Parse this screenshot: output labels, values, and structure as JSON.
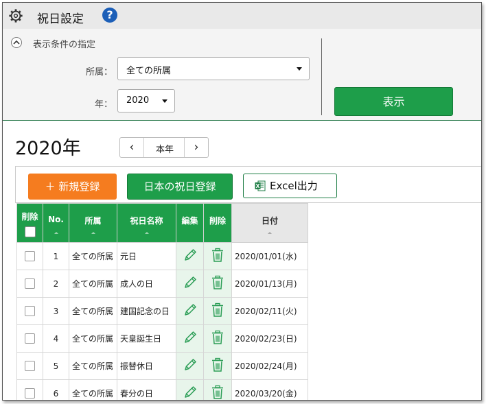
{
  "header": {
    "title": "祝日設定",
    "help_label": "?"
  },
  "filter": {
    "section_title": "表示条件の指定",
    "dept_label": "所属：",
    "dept_value": "全ての所属",
    "year_label": "年：",
    "year_value": "2020",
    "show_button": "表示"
  },
  "year_nav": {
    "title": "2020年",
    "prev": "‹",
    "current": "本年",
    "next": "›"
  },
  "toolbar": {
    "new_button": "＋ 新規登録",
    "jp_holiday_button": "日本の祝日登録",
    "excel_button": "Excel出力"
  },
  "table": {
    "headers": {
      "delete": "削除",
      "no": "No.",
      "dept": "所属",
      "name": "祝日名称",
      "edit": "編集",
      "delete2": "削除",
      "date": "日付"
    },
    "rows": [
      {
        "no": "1",
        "dept": "全ての所属",
        "name": "元日",
        "date": "2020/01/01(水)"
      },
      {
        "no": "2",
        "dept": "全ての所属",
        "name": "成人の日",
        "date": "2020/01/13(月)"
      },
      {
        "no": "3",
        "dept": "全ての所属",
        "name": "建国記念の日",
        "date": "2020/02/11(火)"
      },
      {
        "no": "4",
        "dept": "全ての所属",
        "name": "天皇誕生日",
        "date": "2020/02/23(日)"
      },
      {
        "no": "5",
        "dept": "全ての所属",
        "name": "振替休日",
        "date": "2020/02/24(月)"
      },
      {
        "no": "6",
        "dept": "全ての所属",
        "name": "春分の日",
        "date": "2020/03/20(金)"
      }
    ]
  },
  "colors": {
    "green": "#1e9e4a",
    "orange": "#f57c1f",
    "help_blue": "#1c5fb8"
  }
}
